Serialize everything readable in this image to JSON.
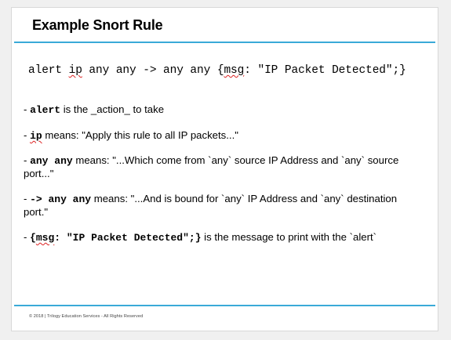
{
  "slide": {
    "title": "Example Snort Rule",
    "code": {
      "pre": "alert ",
      "ip": "ip",
      "mid": " any any -> any any {",
      "msg": "msg",
      "post": ": \"IP Packet Detected\";}"
    },
    "bullets": [
      {
        "dash": "- ",
        "code": "alert",
        "text": " is the _action_ to take"
      },
      {
        "dash": "- ",
        "code": "ip",
        "text": " means: \"Apply this rule to all IP packets...\""
      },
      {
        "dash": "- ",
        "code": "any any",
        "text": "  means: \"...Which come from `any` source IP Address and `any` source port...\""
      },
      {
        "dash": "- ",
        "code": "-> any any",
        "text": " means: \"...And is bound for `any` IP Address and `any` destination port.\""
      },
      {
        "dash": "- ",
        "code_open": "{",
        "code_msg": "msg",
        "code_rest": ": \"IP Packet Detected\";}",
        "text": "  is the message to print with the `alert`"
      }
    ],
    "footer": "© 2018 | Trilogy Education Services - All Rights Reserved"
  }
}
